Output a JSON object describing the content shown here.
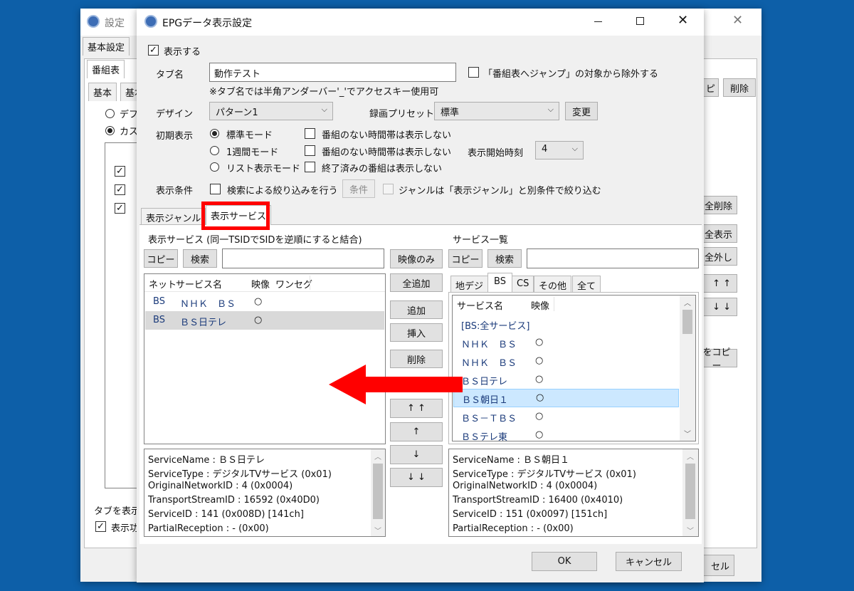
{
  "bg_window": {
    "title": "設定",
    "tab_basic": "基本設定",
    "tab_program": "番組表",
    "sub_tab1": "基本",
    "sub_tab2": "基本",
    "radio1": "デフ",
    "radio2": "カス",
    "btn_del_frag": "ピ",
    "btn_delete": "削除",
    "btn_all_delete": "全削除",
    "btn_all_show": "全表示",
    "btn_all_hide": "全外し",
    "btn_up": "↑ ↑",
    "btn_down": "↓ ↓",
    "btn_copy": "をコピー",
    "bottom_label": "タブを表示",
    "bottom_check": "表示功",
    "cancel_frag": "セル"
  },
  "dialog": {
    "title": "EPGデータ表示設定",
    "show_check": "表示する",
    "tab_name_label": "タブ名",
    "tab_name_value": "動作テスト",
    "exclude_jump": "「番組表へジャンプ」の対象から除外する",
    "hint": "※タブ名では半角アンダーバー'_'でアクセスキー使用可",
    "design_label": "デザイン",
    "design_value": "パターン1",
    "preset_label": "録画プリセット",
    "preset_value": "標準",
    "change_button": "変更",
    "initial_label": "初期表示",
    "mode_standard": "標準モード",
    "mode_week": "1週間モード",
    "mode_list": "リスト表示モード",
    "opt_no_program1": "番組のない時間帯は表示しない",
    "opt_no_program2": "番組のない時間帯は表示しない",
    "opt_finished": "終了済みの番組は表示しない",
    "start_time_label": "表示開始時刻",
    "start_time_value": "4",
    "cond_label": "表示条件",
    "cond_search": "検索による絞り込みを行う",
    "cond_button": "条件",
    "cond_genre": "ジャンルは「表示ジャンル」と別条件で絞り込む",
    "tab_genre": "表示ジャンル",
    "tab_service": "表示サービス",
    "ok": "OK",
    "cancel": "キャンセル"
  },
  "left_pane": {
    "heading": "表示サービス (同一TSIDでSIDを逆順にすると結合)",
    "copy": "コピー",
    "search": "検索",
    "search_value": "",
    "columns": [
      "ネット",
      "サービス名",
      "映像",
      "ワンセグ"
    ],
    "rows": [
      {
        "net": "BS",
        "name": "ＮＨＫ　ＢＳ",
        "video": "○"
      },
      {
        "net": "BS",
        "name": "ＢＳ日テレ",
        "video": "○"
      }
    ],
    "info": [
      "ServiceName : ＢＳ日テレ",
      "ServiceType : デジタルTVサービス (0x01)",
      "OriginalNetworkID : 4 (0x0004)",
      "TransportStreamID : 16592 (0x40D0)",
      "ServiceID : 141 (0x008D) [141ch]",
      "PartialReception : - (0x00)"
    ]
  },
  "middle": {
    "video_only": "映像のみ",
    "add_all": "全追加",
    "add": "追加",
    "insert": "挿入",
    "delete": "削除",
    "top": "↑ ↑",
    "up": "↑",
    "down": "↓",
    "bottom": "↓ ↓"
  },
  "right_pane": {
    "heading": "サービス一覧",
    "copy": "コピー",
    "search": "検索",
    "search_value": "",
    "tabs": [
      "地デジ",
      "BS",
      "CS",
      "その他",
      "全て"
    ],
    "columns": [
      "サービス名",
      "映像"
    ],
    "rows": [
      {
        "name": "[BS:全サービス]",
        "video": ""
      },
      {
        "name": "ＮＨＫ　ＢＳ",
        "video": "○"
      },
      {
        "name": "ＮＨＫ　ＢＳ",
        "video": "○"
      },
      {
        "name": "ＢＳ日テレ",
        "video": "○"
      },
      {
        "name": "ＢＳ朝日１",
        "video": "○"
      },
      {
        "name": "ＢＳ－ＴＢＳ",
        "video": "○"
      },
      {
        "name": "ＢＳテレ東",
        "video": "○"
      }
    ],
    "info": [
      "ServiceName : ＢＳ朝日１",
      "ServiceType : デジタルTVサービス (0x01)",
      "OriginalNetworkID : 4 (0x0004)",
      "TransportStreamID : 16400 (0x4010)",
      "ServiceID : 151 (0x0097) [151ch]",
      "PartialReception : - (0x00)"
    ]
  },
  "colors": {
    "highlight_red": "#ff0000",
    "selection_blue": "#cce8ff",
    "desktop": "#0d5fa8"
  }
}
